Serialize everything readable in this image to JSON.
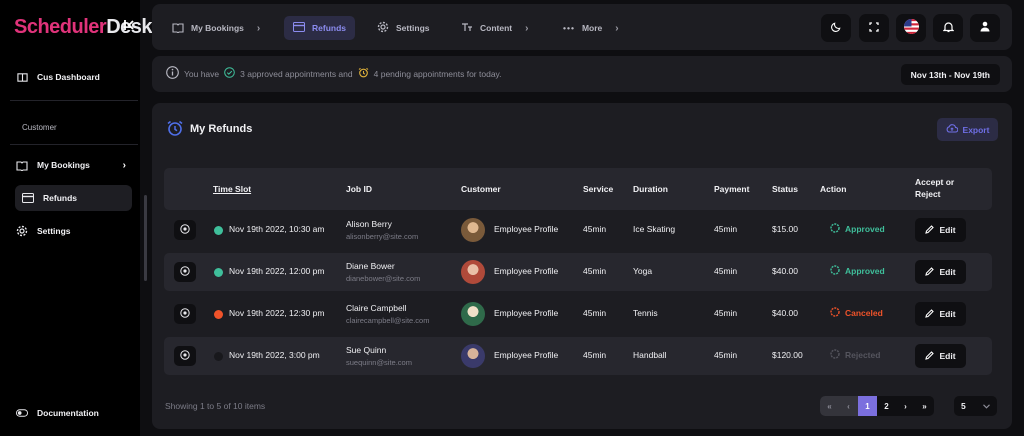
{
  "app": {
    "logo_part1": "Scheduler",
    "logo_part2": "Desk",
    "collapse_icon": "«"
  },
  "sidebar": {
    "top_item": {
      "label": "Cus Dashboard",
      "icon": "book-open-icon"
    },
    "section_label": "Customer",
    "items": [
      {
        "label": "My Bookings",
        "icon": "book-open-icon",
        "has_chevron": true
      },
      {
        "label": "Refunds",
        "icon": "credit-card-icon",
        "active": true
      },
      {
        "label": "Settings",
        "icon": "gear-icon"
      }
    ],
    "bottom_item": {
      "label": "Documentation",
      "icon": "toggle-icon"
    }
  },
  "topnav": {
    "items": [
      {
        "label": "My Bookings",
        "icon": "book-open-icon",
        "has_chevron": true
      },
      {
        "label": "Refunds",
        "icon": "credit-card-icon",
        "active": true
      },
      {
        "label": "Settings",
        "icon": "gear-icon"
      },
      {
        "label": "Content",
        "icon": "text-icon",
        "has_chevron": true
      },
      {
        "label": "More",
        "icon": "ellipsis-icon",
        "has_chevron": true
      }
    ],
    "chevron": "›",
    "buttons": [
      "moon-icon",
      "fullscreen-icon",
      "us-flag-icon",
      "bell-icon",
      "user-icon"
    ]
  },
  "infobar": {
    "prefix": "You have",
    "approved_text": "3 approved appointments and",
    "pending_text": "4 pending appointments for today.",
    "date_range": "Nov 13th - Nov 19th"
  },
  "refunds": {
    "title": "My Refunds",
    "export_label": "Export",
    "columns": {
      "time_slot": "Time Slot",
      "job_id": "Job ID",
      "customer": "Customer",
      "service": "Service",
      "duration": "Duration",
      "payment": "Payment",
      "status": "Status",
      "action": "Action",
      "accept_line1": "Accept or",
      "accept_line2": "Reject"
    },
    "rows": [
      {
        "dot_color": "#3fbf9b",
        "time": "Nov 19th 2022, 10:30 am",
        "name": "Alison Berry",
        "email": "alisonberry@site.com",
        "customer": "Employee Profile",
        "service": "45min",
        "duration": "Ice Skating",
        "payment": "45min",
        "status": "$15.00",
        "action": "Approved",
        "action_color": "#3fbf9b",
        "edit": "Edit",
        "avatar": "#7a5a3a"
      },
      {
        "dot_color": "#3fbf9b",
        "time": "Nov 19th 2022, 12:00 pm",
        "name": "Diane Bower",
        "email": "dianebower@site.com",
        "customer": "Employee Profile",
        "service": "45min",
        "duration": "Yoga",
        "payment": "45min",
        "status": "$40.00",
        "action": "Approved",
        "action_color": "#3fbf9b",
        "edit": "Edit",
        "avatar": "#b04a3a"
      },
      {
        "dot_color": "#f0532a",
        "time": "Nov 19th 2022, 12:30 pm",
        "name": "Claire Campbell",
        "email": "clairecampbell@site.com",
        "customer": "Employee Profile",
        "service": "45min",
        "duration": "Tennis",
        "payment": "45min",
        "status": "$40.00",
        "action": "Canceled",
        "action_color": "#f0532a",
        "edit": "Edit",
        "avatar": "#2f6a4a"
      },
      {
        "dot_color": "#2a2a30",
        "time": "Nov 19th 2022, 3:00 pm",
        "name": "Sue Quinn",
        "email": "suequinn@site.com",
        "customer": "Employee Profile",
        "service": "45min",
        "duration": "Handball",
        "payment": "45min",
        "status": "$120.00",
        "action": "Rejected",
        "action_color": "#55555e",
        "edit": "Edit",
        "avatar": "#3a3a6a"
      }
    ],
    "showing_text": "Showing 1 to 5 of 10 items",
    "pagination": {
      "first": "«",
      "prev": "‹",
      "pages": [
        "1",
        "2"
      ],
      "current": "1",
      "next": "›",
      "last": "»"
    },
    "page_size": "5"
  },
  "colors": {
    "accent": "#7b6fde",
    "approved": "#3fbf9b",
    "canceled": "#f0532a",
    "warning": "#e0b23a"
  }
}
